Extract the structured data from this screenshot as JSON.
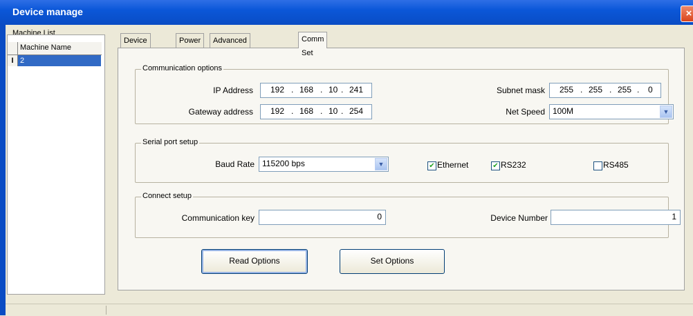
{
  "window": {
    "title": "Device manage",
    "close_label": "×"
  },
  "machine_list": {
    "legend": "Machine List",
    "column_header": "Machine Name",
    "rows": [
      {
        "indicator": "I",
        "name": "2"
      }
    ]
  },
  "tabs": [
    {
      "label": "Device Info"
    },
    {
      "label": "Power"
    },
    {
      "label": "Advanced Function"
    },
    {
      "label": "Comm Set",
      "active": true
    }
  ],
  "comm_options": {
    "legend": "Communication options",
    "ip_label": "IP Address",
    "ip": [
      "192",
      "168",
      "10",
      "241"
    ],
    "subnet_label": "Subnet mask",
    "subnet": [
      "255",
      "255",
      "255",
      "0"
    ],
    "gateway_label": "Gateway address",
    "gateway": [
      "192",
      "168",
      "10",
      "254"
    ],
    "netspeed_label": "Net Speed",
    "netspeed_value": "100M"
  },
  "serial_setup": {
    "legend": "Serial port setup",
    "baud_label": "Baud Rate",
    "baud_value": "115200 bps",
    "ethernet_label": "Ethernet",
    "ethernet_checked": true,
    "rs232_label": "RS232",
    "rs232_checked": true,
    "rs485_label": "RS485",
    "rs485_checked": false
  },
  "connect_setup": {
    "legend": "Connect setup",
    "commkey_label": "Communication key",
    "commkey_value": "0",
    "devnum_label": "Device Number",
    "devnum_value": "1"
  },
  "buttons": {
    "read": "Read Options",
    "set": "Set Options"
  },
  "icons": {
    "dropdown": "chevron-down-icon",
    "checkmark": "checkmark-icon",
    "close": "close-icon"
  },
  "colors": {
    "titlebar": "#0b57d8",
    "selection": "#316ac5",
    "dialog_bg": "#ece9d8"
  }
}
